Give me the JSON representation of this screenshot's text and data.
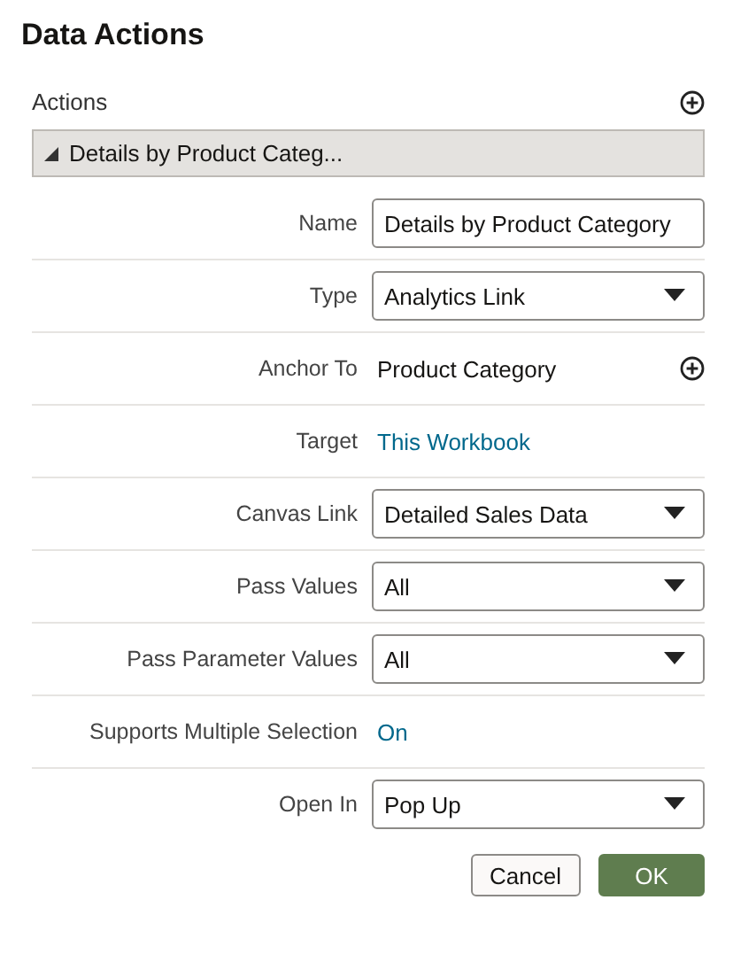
{
  "title": "Data Actions",
  "actions": {
    "label": "Actions",
    "items": [
      {
        "label": "Details by Product Categ...",
        "expanded": true,
        "selected": true
      }
    ]
  },
  "fields": [
    {
      "label": "Name",
      "kind": "input",
      "value": "Details by Product Category"
    },
    {
      "label": "Type",
      "kind": "select",
      "value": "Analytics Link"
    },
    {
      "label": "Anchor To",
      "kind": "text",
      "value": "Product Category"
    },
    {
      "label": "Target",
      "kind": "link",
      "value": "This Workbook"
    },
    {
      "label": "Canvas Link",
      "kind": "select",
      "value": "Detailed Sales Data"
    },
    {
      "label": "Pass Values",
      "kind": "select",
      "value": "All"
    },
    {
      "label": "Pass Parameter Values",
      "kind": "select",
      "value": "All"
    },
    {
      "label": "Supports Multiple Selection",
      "kind": "link",
      "value": "On"
    },
    {
      "label": "Open In",
      "kind": "select",
      "value": "Pop Up"
    }
  ],
  "buttons": [
    {
      "label": "Cancel",
      "kind": "secondary"
    },
    {
      "label": "OK",
      "kind": "primary"
    }
  ]
}
